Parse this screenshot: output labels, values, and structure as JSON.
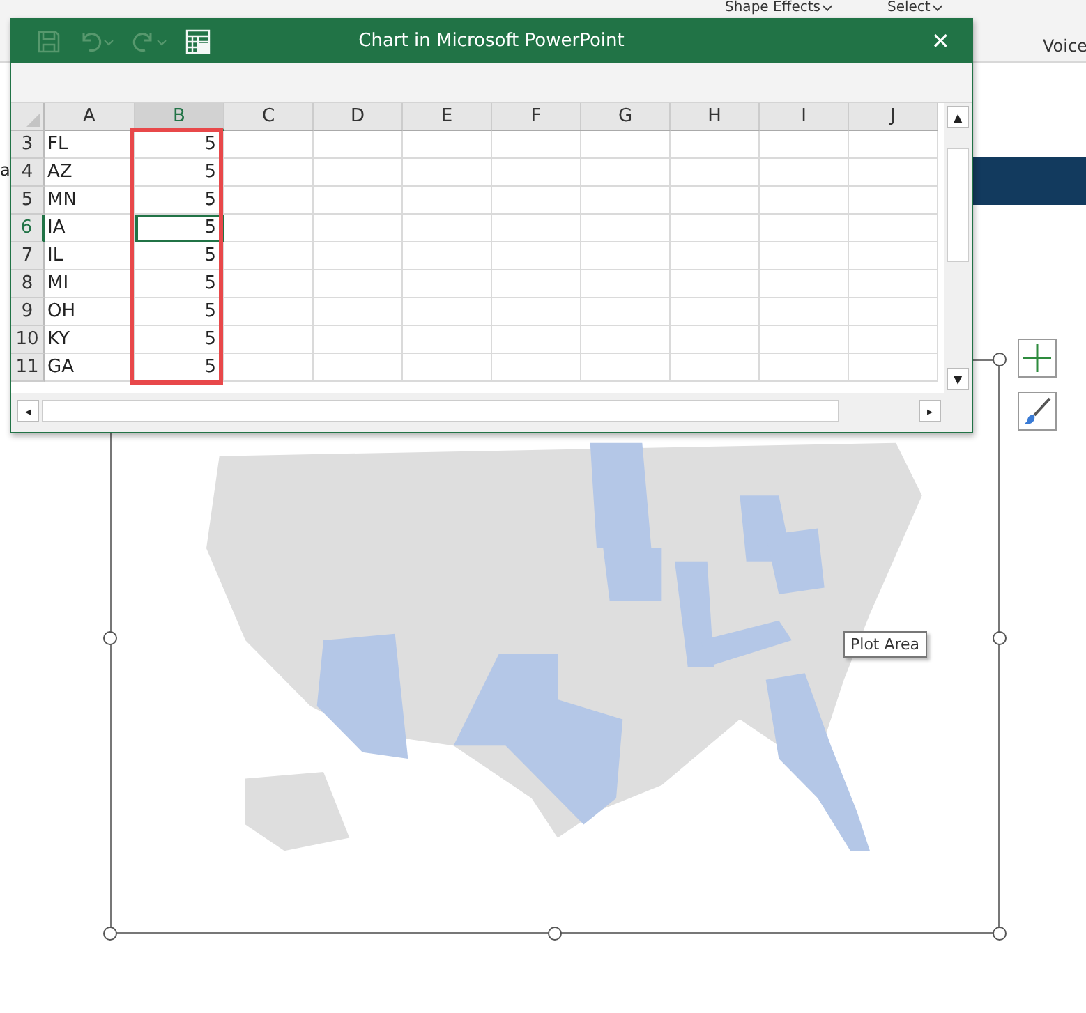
{
  "ribbon": {
    "items": [
      {
        "label": "Shape Effects",
        "dropdown": true
      },
      {
        "label": "Select",
        "dropdown": true
      }
    ],
    "group_label": "Voice"
  },
  "slide": {
    "edge_text": "a",
    "tooltip": "Plot Area"
  },
  "window": {
    "title": "Chart in Microsoft PowerPoint",
    "close": "✕",
    "scroll_up": "▲",
    "scroll_down": "▼",
    "scroll_left": "◂",
    "scroll_right": "▸"
  },
  "sheet": {
    "columns": [
      {
        "label": "A",
        "selected": false
      },
      {
        "label": "B",
        "selected": true
      },
      {
        "label": "C",
        "selected": false
      },
      {
        "label": "D",
        "selected": false
      },
      {
        "label": "E",
        "selected": false
      },
      {
        "label": "F",
        "selected": false
      },
      {
        "label": "G",
        "selected": false
      },
      {
        "label": "H",
        "selected": false
      },
      {
        "label": "I",
        "selected": false
      },
      {
        "label": "J",
        "selected": false
      }
    ],
    "rows": [
      {
        "number": "3",
        "selected": false,
        "cells": [
          "FL",
          "5"
        ]
      },
      {
        "number": "4",
        "selected": false,
        "cells": [
          "AZ",
          "5"
        ]
      },
      {
        "number": "5",
        "selected": false,
        "cells": [
          "MN",
          "5"
        ]
      },
      {
        "number": "6",
        "selected": true,
        "cells": [
          "IA",
          "5"
        ]
      },
      {
        "number": "7",
        "selected": false,
        "cells": [
          "IL",
          "5"
        ]
      },
      {
        "number": "8",
        "selected": false,
        "cells": [
          "MI",
          "5"
        ]
      },
      {
        "number": "9",
        "selected": false,
        "cells": [
          "OH",
          "5"
        ]
      },
      {
        "number": "10",
        "selected": false,
        "cells": [
          "KY",
          "5"
        ]
      },
      {
        "number": "11",
        "selected": false,
        "cells": [
          "GA",
          "5"
        ]
      }
    ]
  }
}
